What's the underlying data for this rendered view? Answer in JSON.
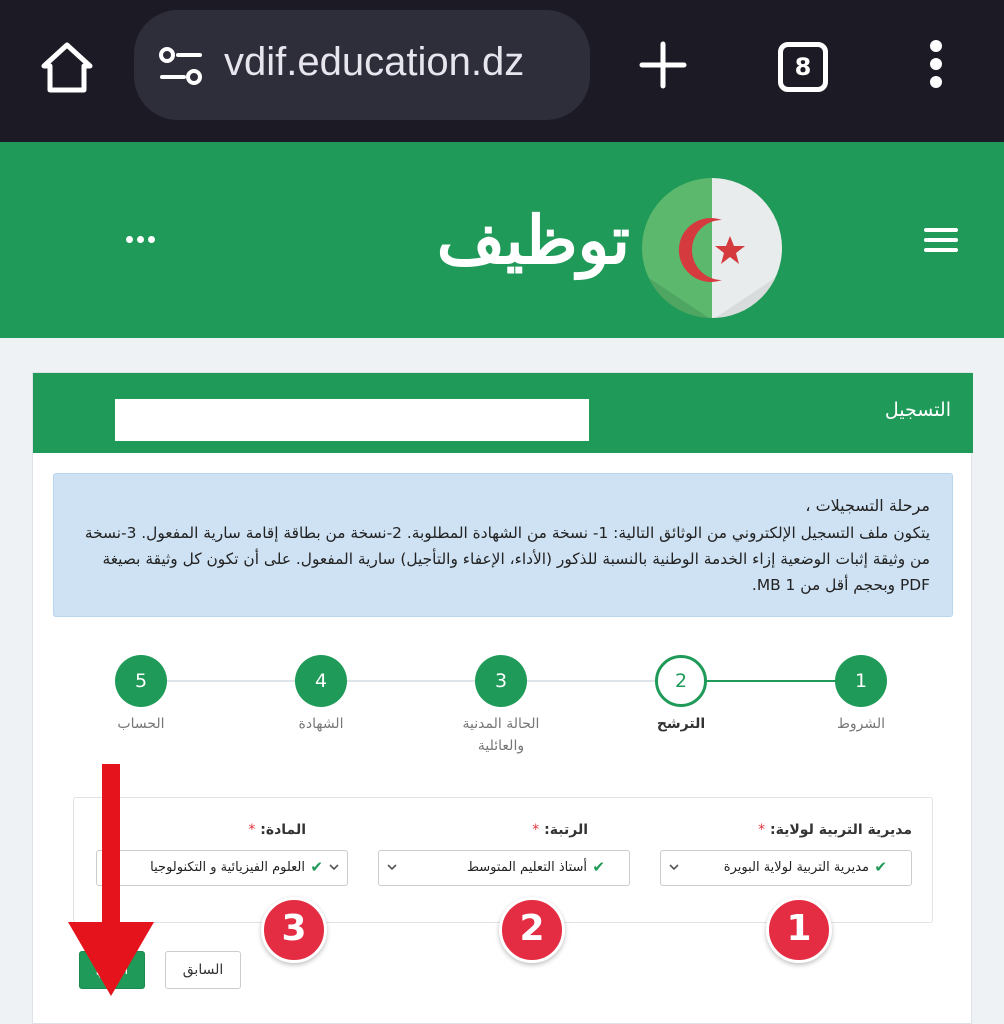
{
  "browser": {
    "url": "vdif.education.dz",
    "tab_count": "8",
    "icons": [
      "home-icon",
      "tune-icon",
      "plus-icon",
      "tabs-icon",
      "more-vert-icon"
    ]
  },
  "header": {
    "logo_text": "توظيف",
    "icons": [
      "more-horiz-icon",
      "algeria-flag-emblem",
      "hamburger-menu-icon"
    ],
    "color": "#1f9a58"
  },
  "card": {
    "title": "التسجيل"
  },
  "notice": {
    "title": "مرحلة التسجيلات ،",
    "body": "يتكون ملف التسجيل الإلكتروني من الوثائق التالية: 1- نسخة من الشهادة المطلوبة. 2-نسخة من بطاقة إقامة سارية المفعول. 3-نسخة من وثيقة إثبات الوضعية إزاء الخدمة الوطنية بالنسبة للذكور (الأداء، الإعفاء والتأجيل) سارية المفعول. على أن تكون كل وثيقة بصيغة PDF وبحجم أقل من MB 1."
  },
  "steps": [
    {
      "number": "1",
      "label": "الشروط",
      "state": "done"
    },
    {
      "number": "2",
      "label": "الترشح",
      "state": "active"
    },
    {
      "number": "3",
      "label": "الحالة المدنية والعائلية",
      "state": "pending"
    },
    {
      "number": "4",
      "label": "الشهادة",
      "state": "pending"
    },
    {
      "number": "5",
      "label": "الحساب",
      "state": "pending"
    }
  ],
  "form": {
    "directorate": {
      "label": "مديرية التربية لولاية:",
      "required": "*",
      "value": "مديرية التربية لولاية البويرة"
    },
    "rank": {
      "label": "الرتبة:",
      "required": "*",
      "value": "أستاذ التعليم المتوسط"
    },
    "subject": {
      "label": "المادة:",
      "required": "*",
      "value": "العلوم الفيزيائية و التكنولوجيا"
    }
  },
  "annotations": {
    "badges": [
      "1",
      "2",
      "3"
    ],
    "badge_color": "#e42c43",
    "arrow_color": "#e5141c"
  },
  "buttons": {
    "next": "التالي",
    "previous": "السابق"
  }
}
